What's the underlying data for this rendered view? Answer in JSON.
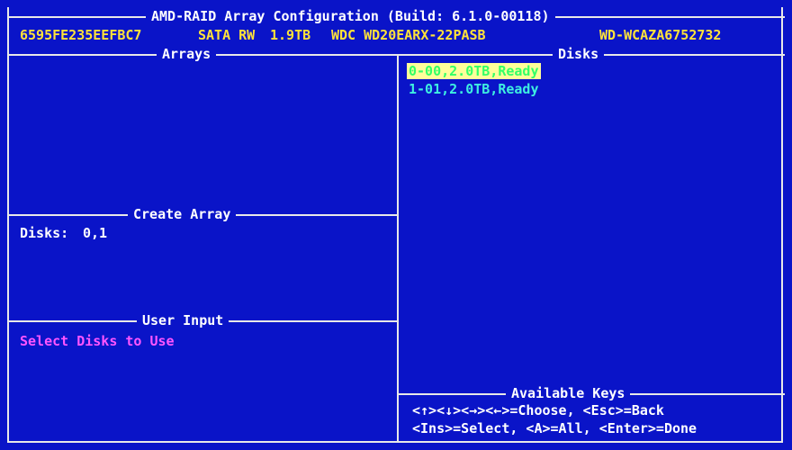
{
  "header": {
    "title": "AMD-RAID Array Configuration (Build: 6.1.0-00118)",
    "disk_id": "6595FE235EEFBC7",
    "disk_type": "SATA RW",
    "disk_size": "1.9TB",
    "disk_model": "WDC WD20EARX-22PASB",
    "disk_serial": "WD-WCAZA6752732"
  },
  "arrays_panel": {
    "title": "Arrays"
  },
  "create_array_panel": {
    "title": "Create Array",
    "disks_label": "Disks:",
    "disks_value": "0,1"
  },
  "user_input_panel": {
    "title": "User Input",
    "message": "Select Disks to Use"
  },
  "disks_panel": {
    "title": "Disks",
    "items": [
      {
        "label": "0-00,2.0TB,Ready",
        "selected": true
      },
      {
        "label": "1-01,2.0TB,Ready",
        "selected": false
      }
    ]
  },
  "keys_panel": {
    "title": "Available Keys",
    "line1": "<↑><↓><→><←>=Choose, <Esc>=Back",
    "line2": "<Ins>=Select, <A>=All, <Enter>=Done"
  },
  "colors": {
    "background": "#0a14c8",
    "header_text": "#ffe23a",
    "disk_text": "#3ef0e0",
    "message_text": "#ff55ff",
    "highlight": "#fffe9a"
  }
}
